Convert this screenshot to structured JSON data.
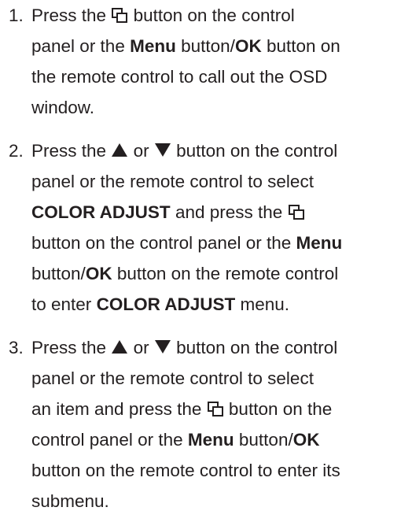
{
  "steps": [
    {
      "number": "1.",
      "l1a": "Press the",
      "l1b": "button on the control",
      "l2a": "panel or the",
      "l2menu": "Menu",
      "l2b": "button/",
      "l2ok": "OK",
      "l2c": "button on",
      "l3": "the remote control to call out the OSD",
      "l4": "window."
    },
    {
      "number": "2.",
      "l1a": "Press the",
      "l1or": "or",
      "l1b": "button on the control",
      "l2": "panel or the remote control to select",
      "l3bold": "COLOR ADJUST",
      "l3a": "and press the",
      "l4a": "button on the control panel or the",
      "l4menu": "Menu",
      "l5a": "button/",
      "l5ok": "OK",
      "l5b": "button on the remote control",
      "l6a": "to enter",
      "l6bold": "COLOR ADJUST",
      "l6b": "menu."
    },
    {
      "number": "3.",
      "l1a": "Press the",
      "l1or": "or",
      "l1b": "button on the control",
      "l2": "panel or the remote control to select",
      "l3a": "an item and press the",
      "l3b": "button on the",
      "l4a": "control panel or the",
      "l4menu": "Menu",
      "l4b": "button/",
      "l4ok": "OK",
      "l5": "button on the remote control to enter its",
      "l6": "submenu."
    }
  ],
  "icons": [
    "menu-button-icon",
    "up-triangle-icon",
    "down-triangle-icon"
  ]
}
